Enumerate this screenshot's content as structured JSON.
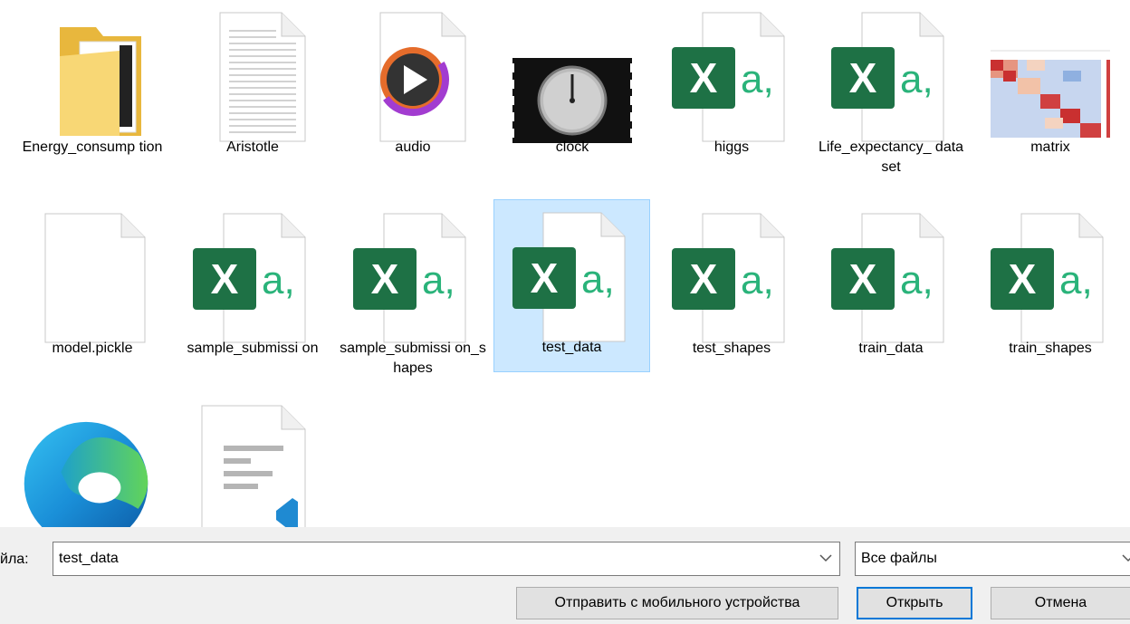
{
  "files": [
    {
      "name": "Energy_consump tion",
      "icon": "folder-icon"
    },
    {
      "name": "Aristotle",
      "icon": "text-document-icon"
    },
    {
      "name": "audio",
      "icon": "media-player-icon"
    },
    {
      "name": "clock",
      "icon": "video-thumbnail-icon"
    },
    {
      "name": "higgs",
      "icon": "excel-csv-icon"
    },
    {
      "name": "Life_expectancy_ dataset",
      "icon": "excel-csv-icon"
    },
    {
      "name": "matrix",
      "icon": "image-thumbnail-icon"
    },
    {
      "name": "model.pickle",
      "icon": "blank-file-icon"
    },
    {
      "name": "sample_submissi on",
      "icon": "excel-csv-icon"
    },
    {
      "name": "sample_submissi on_shapes",
      "icon": "excel-csv-icon"
    },
    {
      "name": "test_data",
      "icon": "excel-csv-icon",
      "selected": true
    },
    {
      "name": "test_shapes",
      "icon": "excel-csv-icon"
    },
    {
      "name": "train_data",
      "icon": "excel-csv-icon"
    },
    {
      "name": "train_shapes",
      "icon": "excel-csv-icon"
    },
    {
      "name": "",
      "icon": "edge-browser-icon"
    },
    {
      "name": "",
      "icon": "vscode-file-icon"
    }
  ],
  "dialog": {
    "filename_label": "йла:",
    "filename_value": "test_data",
    "filter_value": "Все файлы",
    "send_mobile_label": "Отправить с мобильного устройства",
    "open_label": "Открыть",
    "cancel_label": "Отмена"
  },
  "colors": {
    "excel_green": "#1e7145",
    "selection_bg": "#cce8ff",
    "selection_border": "#99d1ff",
    "primary_border": "#0078d7",
    "folder_yellow": "#f8d775"
  }
}
